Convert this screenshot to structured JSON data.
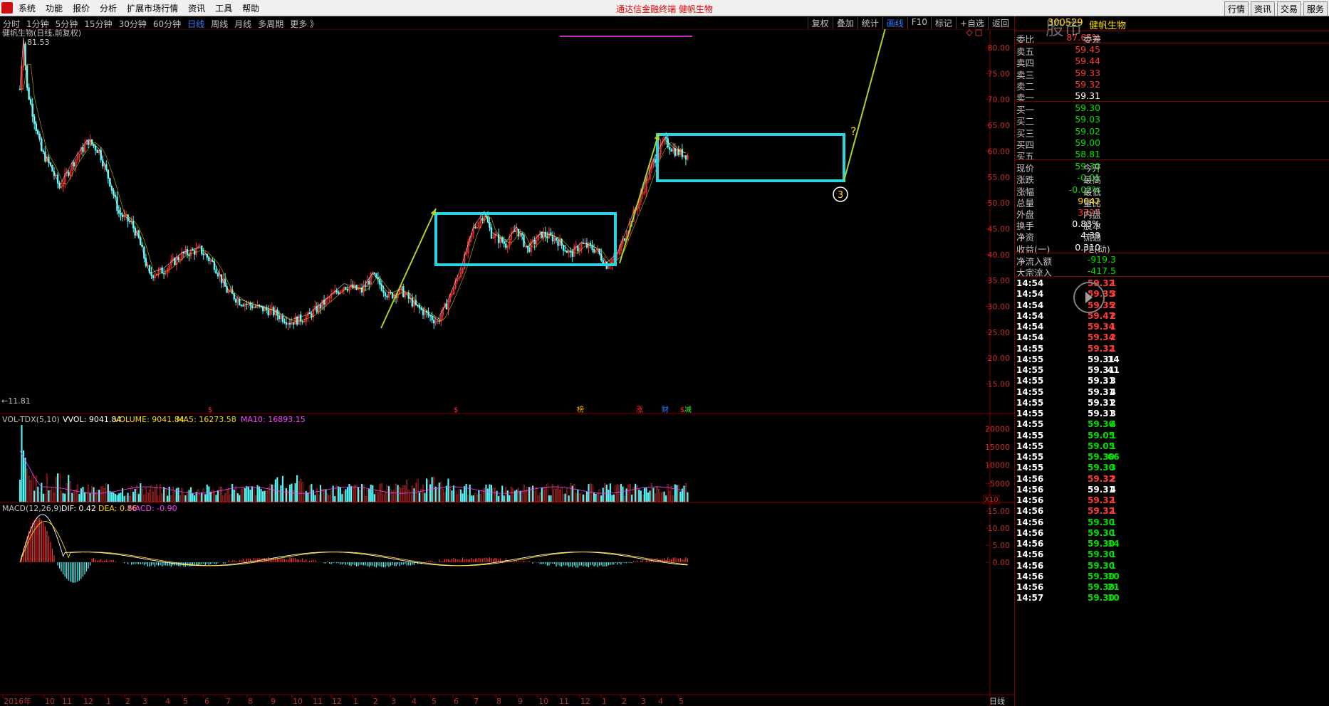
{
  "menubar": {
    "items": [
      "系统",
      "功能",
      "报价",
      "分析",
      "扩展市场行情",
      "资讯",
      "工具",
      "帮助"
    ],
    "title": "通达信金融终端  健帆生物",
    "right_buttons": [
      "行情",
      "资讯",
      "交易",
      "服务"
    ]
  },
  "periodbar": {
    "items": [
      "分时",
      "1分钟",
      "5分钟",
      "15分钟",
      "30分钟",
      "60分钟",
      "日线",
      "周线",
      "月线",
      "多周期",
      "更多 》"
    ],
    "active": "日线",
    "tools": [
      "复权",
      "叠加",
      "统计",
      "画线",
      "F10",
      "标记",
      "+自选",
      "返回"
    ],
    "active_tool": "画线"
  },
  "chart": {
    "header": "健帆生物(日线,前复权)",
    "high_label": "81.53",
    "low_label": "←11.81",
    "y_ticks": [
      "80.00",
      "75.00",
      "70.00",
      "65.00",
      "60.00",
      "55.00",
      "50.00",
      "45.00",
      "40.00",
      "35.00",
      "30.00",
      "25.00",
      "20.00",
      "15.00"
    ],
    "question_mark": "?",
    "wave_label": "3",
    "event_marks": [
      "$",
      "$",
      "榜",
      "涨",
      "财",
      "$",
      "减"
    ],
    "colors": {
      "up": "#ff3232",
      "down": "#54fcfc",
      "box": "#2ad4e0",
      "arrow": "#a8d42a",
      "ma5": "#ffffff",
      "ma10": "#ffd800"
    }
  },
  "volume": {
    "title": "VOL-TDX(5,10)",
    "vvol": "VVOL: 9041.84",
    "volume": "VOLUME: 9041.84",
    "ma5": "MA5: 16273.58",
    "ma10": "MA10: 16893.15",
    "y_ticks": [
      "20000",
      "15000",
      "10000",
      "5000"
    ],
    "unit": "X10"
  },
  "macd": {
    "title": "MACD(12,26,9)",
    "dif": "DIF: 0.42",
    "dea": "DEA: 0.86",
    "macd": "MACD: -0.90",
    "y_ticks": [
      "15.00",
      "10.00",
      "5.00",
      "0.00"
    ]
  },
  "x_axis": {
    "labels": [
      "2016年",
      "10",
      "11",
      "12",
      "1",
      "2",
      "3",
      "4",
      "5",
      "6",
      "7",
      "8",
      "9",
      "10",
      "11",
      "12",
      "1",
      "2",
      "3",
      "4",
      "5",
      "6",
      "7",
      "8",
      "9",
      "10",
      "11",
      "12",
      "1",
      "2",
      "3",
      "4",
      "5"
    ],
    "period": "日线"
  },
  "quote": {
    "code": "300529",
    "name": "健帆生物",
    "weibi_label": "委比",
    "weibi": "87.65%",
    "weicha_label": "委差",
    "asks": [
      {
        "label": "卖五",
        "price": "59.45"
      },
      {
        "label": "卖四",
        "price": "59.44"
      },
      {
        "label": "卖三",
        "price": "59.33"
      },
      {
        "label": "卖二",
        "price": "59.32"
      },
      {
        "label": "卖一",
        "price": "59.31"
      }
    ],
    "bids": [
      {
        "label": "买一",
        "price": "59.30"
      },
      {
        "label": "买二",
        "price": "59.03"
      },
      {
        "label": "买三",
        "price": "59.02"
      },
      {
        "label": "买四",
        "price": "59.00"
      },
      {
        "label": "买五",
        "price": "58.81"
      }
    ],
    "stats": [
      {
        "label": "现价",
        "value": "59.30",
        "label2": "今开"
      },
      {
        "label": "涨跌",
        "value": "-0.01",
        "label2": "最高"
      },
      {
        "label": "涨幅",
        "value": "-0.02%",
        "label2": "最低"
      },
      {
        "label": "总量",
        "value": "9042",
        "label2": "量比"
      },
      {
        "label": "外盘",
        "value": "3727",
        "label2": "内盘"
      },
      {
        "label": "换手",
        "value": "0.83%",
        "label2": "股本"
      },
      {
        "label": "净资",
        "value": "4.39",
        "label2": "流通"
      },
      {
        "label": "收益(一)",
        "value": "0.310",
        "label2": "PE(动)"
      }
    ],
    "flow": [
      {
        "label": "净流入额",
        "value": "-919.3"
      },
      {
        "label": "大宗流入",
        "value": "-417.5"
      }
    ],
    "ticks": [
      {
        "t": "14:54",
        "p": "59.32",
        "v": "1",
        "c": "red"
      },
      {
        "t": "14:54",
        "p": "59.35",
        "v": "3",
        "c": "red"
      },
      {
        "t": "14:54",
        "p": "59.35",
        "v": "2",
        "c": "red"
      },
      {
        "t": "14:54",
        "p": "59.47",
        "v": "2",
        "c": "red"
      },
      {
        "t": "14:54",
        "p": "59.34",
        "v": "1",
        "c": "red"
      },
      {
        "t": "14:54",
        "p": "59.34",
        "v": "2",
        "c": "red"
      },
      {
        "t": "14:55",
        "p": "59.32",
        "v": "1",
        "c": "red"
      },
      {
        "t": "14:55",
        "p": "59.31",
        "v": "14",
        "c": "white"
      },
      {
        "t": "14:55",
        "p": "59.31",
        "v": "41",
        "c": "white"
      },
      {
        "t": "14:55",
        "p": "59.31",
        "v": "3",
        "c": "white"
      },
      {
        "t": "14:55",
        "p": "59.31",
        "v": "4",
        "c": "white"
      },
      {
        "t": "14:55",
        "p": "59.31",
        "v": "2",
        "c": "white"
      },
      {
        "t": "14:55",
        "p": "59.31",
        "v": "3",
        "c": "white"
      },
      {
        "t": "14:55",
        "p": "59.30",
        "v": "4",
        "c": "green"
      },
      {
        "t": "14:55",
        "p": "59.05",
        "v": "1",
        "c": "green"
      },
      {
        "t": "14:55",
        "p": "59.05",
        "v": "1",
        "c": "green"
      },
      {
        "t": "14:55",
        "p": "59.30",
        "v": "66",
        "c": "green"
      },
      {
        "t": "14:55",
        "p": "59.30",
        "v": "3",
        "c": "green"
      },
      {
        "t": "14:56",
        "p": "59.32",
        "v": "2",
        "c": "red"
      },
      {
        "t": "14:56",
        "p": "59.31",
        "v": "4",
        "c": "white"
      },
      {
        "t": "14:56",
        "p": "59.32",
        "v": "1",
        "c": "red"
      },
      {
        "t": "14:56",
        "p": "59.32",
        "v": "1",
        "c": "red"
      },
      {
        "t": "14:56",
        "p": "59.30",
        "v": "1",
        "c": "green"
      },
      {
        "t": "14:56",
        "p": "59.30",
        "v": "1",
        "c": "green"
      },
      {
        "t": "14:56",
        "p": "59.30",
        "v": "14",
        "c": "green"
      },
      {
        "t": "14:56",
        "p": "59.30",
        "v": "1",
        "c": "green"
      },
      {
        "t": "14:56",
        "p": "59.30",
        "v": "1",
        "c": "green"
      },
      {
        "t": "14:56",
        "p": "59.30",
        "v": "10",
        "c": "green"
      },
      {
        "t": "14:56",
        "p": "59.30",
        "v": "21",
        "c": "green"
      },
      {
        "t": "14:57",
        "p": "59.30",
        "v": "10",
        "c": "green"
      }
    ]
  }
}
